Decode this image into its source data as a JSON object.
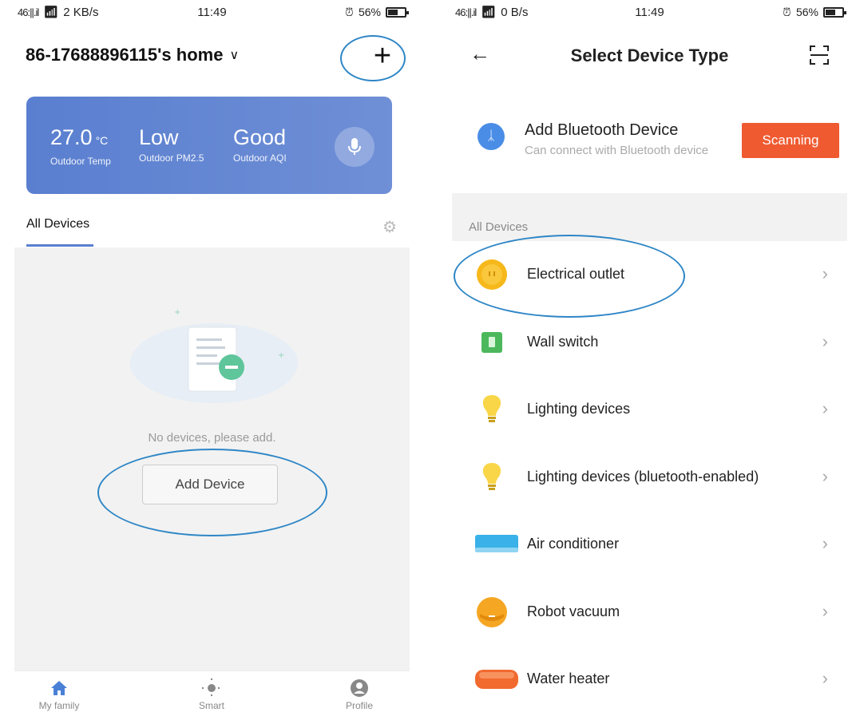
{
  "left": {
    "status": {
      "net": "46:||.il",
      "speed": "2 KB/s",
      "time": "11:49",
      "battery": "56%",
      "battery_level": 0.56
    },
    "home_title": "86-17688896115's home",
    "weather": {
      "temp_value": "27.0",
      "temp_unit": "°C",
      "temp_label": "Outdoor Temp",
      "pm_value": "Low",
      "pm_label": "Outdoor PM2.5",
      "aqi_value": "Good",
      "aqi_label": "Outdoor AQI"
    },
    "tab_all": "All Devices",
    "empty_text": "No devices, please add.",
    "add_device": "Add Device",
    "nav": {
      "family": "My family",
      "smart": "Smart",
      "profile": "Profile"
    }
  },
  "right": {
    "status": {
      "net": "46:||.il",
      "speed": "0 B/s",
      "time": "11:49",
      "battery": "56%",
      "battery_level": 0.56
    },
    "title": "Select Device Type",
    "bluetooth": {
      "title": "Add Bluetooth Device",
      "subtitle": "Can connect with Bluetooth device",
      "scanning": "Scanning"
    },
    "section": "All Devices",
    "devices": [
      {
        "label": "Electrical outlet",
        "icon": "outlet-icon"
      },
      {
        "label": "Wall switch",
        "icon": "wall-switch-icon"
      },
      {
        "label": "Lighting devices",
        "icon": "bulb-icon"
      },
      {
        "label": "Lighting devices (bluetooth-enabled)",
        "icon": "bulb-icon"
      },
      {
        "label": "Air conditioner",
        "icon": "air-conditioner-icon"
      },
      {
        "label": "Robot vacuum",
        "icon": "robot-vacuum-icon"
      },
      {
        "label": "Water heater",
        "icon": "water-heater-icon"
      }
    ]
  },
  "colors": {
    "accent": "#5a7fd0",
    "scanning": "#ef5a30",
    "annotation": "#2e86c6",
    "outlet": "#f6b81a"
  }
}
